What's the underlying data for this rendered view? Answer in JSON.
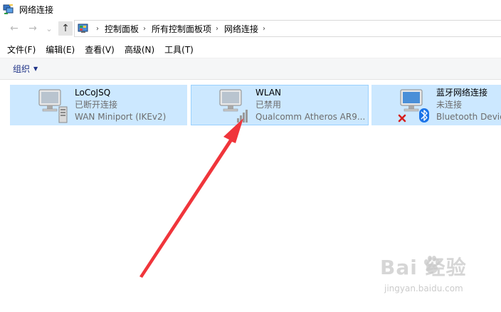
{
  "window": {
    "title": "网络连接"
  },
  "nav": {
    "back_glyph": "←",
    "forward_glyph": "→",
    "recent_glyph": "⌄",
    "up_glyph": "↑",
    "sep_glyph": "›",
    "breadcrumbs": [
      "控制面板",
      "所有控制面板项",
      "网络连接"
    ]
  },
  "menu": {
    "items": [
      "文件(F)",
      "编辑(E)",
      "查看(V)",
      "高级(N)",
      "工具(T)"
    ]
  },
  "toolbar": {
    "organize": "组织",
    "caret": "▼"
  },
  "connections": [
    {
      "name": "LoCoJSQ",
      "status": "已断开连接",
      "device": "WAN Miniport (IKEv2)"
    },
    {
      "name": "WLAN",
      "status": "已禁用",
      "device": "Qualcomm Atheros AR9..."
    },
    {
      "name": "蓝牙网络连接",
      "status": "未连接",
      "device": "Bluetooth Device"
    }
  ],
  "watermark": {
    "main": "Bai  经验",
    "sub": "jingyan.baidu.com"
  },
  "colors": {
    "selection": "#cce8ff",
    "selection_border": "#99d1ff",
    "arrow": "#f0353b",
    "link": "#1e3287"
  }
}
